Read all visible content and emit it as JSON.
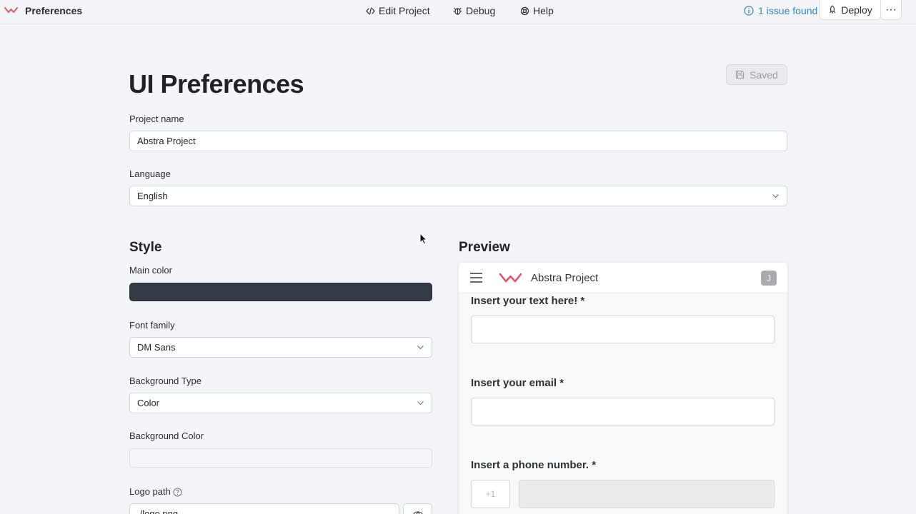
{
  "topbar": {
    "title": "Preferences",
    "nav": [
      {
        "label": "Edit Project",
        "icon": "code-icon"
      },
      {
        "label": "Debug",
        "icon": "bug-icon"
      },
      {
        "label": "Help",
        "icon": "lifebuoy-icon"
      }
    ],
    "issues_label": "1 issue found",
    "deploy_label": "Deploy",
    "more_label": "···",
    "accent_color": "#2f86c9",
    "brand_color": "#e0556b"
  },
  "main": {
    "title": "UI Preferences",
    "saved_label": "Saved",
    "project_name_label": "Project name",
    "project_name_value": "Abstra Project",
    "language_label": "Language",
    "language_value": "English"
  },
  "style": {
    "title": "Style",
    "main_color_label": "Main color",
    "main_color_value": "#343a44",
    "font_family_label": "Font family",
    "font_family_value": "DM Sans",
    "background_type_label": "Background Type",
    "background_type_value": "Color",
    "background_color_label": "Background Color",
    "background_color_value": "",
    "logo_path_label": "Logo path",
    "logo_path_value": "./logo.png"
  },
  "preview": {
    "title": "Preview",
    "project_name": "Abstra Project",
    "avatar_initial": "J",
    "fields": [
      {
        "label": "Insert your text here! *"
      },
      {
        "label": "Insert your email *"
      },
      {
        "label": "Insert a phone number. *"
      }
    ],
    "phone_country_code": "+1"
  }
}
